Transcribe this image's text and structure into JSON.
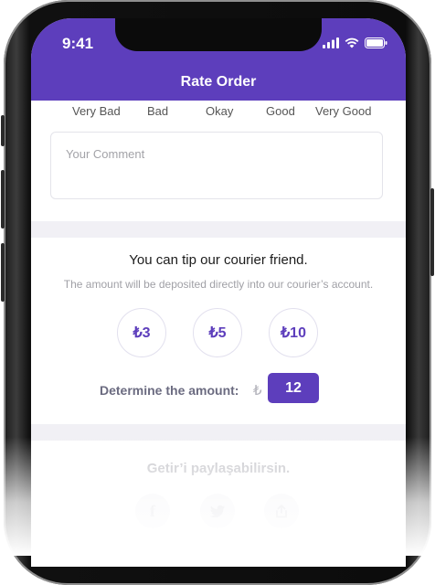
{
  "status_bar": {
    "time": "9:41",
    "signal_icon": "signal-icon",
    "wifi_icon": "wifi-icon",
    "battery_icon": "battery-icon"
  },
  "header": {
    "title": "Rate Order"
  },
  "rating": {
    "labels": [
      "Very Bad",
      "Bad",
      "Okay",
      "Good",
      "Very Good"
    ],
    "comment_placeholder": "Your Comment"
  },
  "tip": {
    "title": "You can tip our courier friend.",
    "subtitle": "The amount will be deposited directly into our courier’s account.",
    "options": [
      "₺3",
      "₺5",
      "₺10"
    ],
    "determine_label": "Determine the amount:",
    "currency_symbol": "₺",
    "amount": "12"
  },
  "share": {
    "title": "Getir’i paylaşabilirsin.",
    "buttons": [
      "facebook-icon",
      "twitter-icon",
      "share-icon"
    ]
  },
  "colors": {
    "brand_purple": "#5d3ebc",
    "background": "#f1f0f5"
  }
}
